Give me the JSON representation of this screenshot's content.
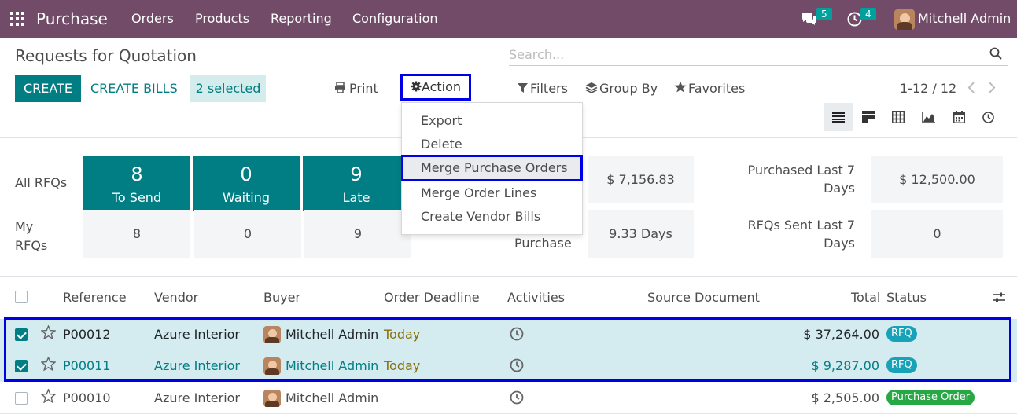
{
  "navbar": {
    "app_name": "Purchase",
    "menu": [
      "Orders",
      "Products",
      "Reporting",
      "Configuration"
    ],
    "messages_count": "5",
    "activities_count": "4",
    "user_name": "Mitchell Admin",
    "bg_color": "#714b67"
  },
  "control_panel": {
    "title": "Requests for Quotation",
    "create_label": "CREATE",
    "create_bills_label": "CREATE BILLS",
    "selected_label": "2 selected",
    "print_label": "Print",
    "action_label": "Action",
    "search_placeholder": "Search...",
    "filters_label": "Filters",
    "group_by_label": "Group By",
    "favorites_label": "Favorites",
    "pager": "1-12 / 12",
    "views": [
      "list-icon",
      "kanban-icon",
      "pivot-icon",
      "graph-icon",
      "calendar-icon",
      "activity-icon"
    ]
  },
  "action_menu": {
    "items": [
      "Export",
      "Delete",
      "Merge Purchase Orders",
      "Merge Order Lines",
      "Create Vendor Bills"
    ],
    "highlighted": "Merge Purchase Orders"
  },
  "dashboard": {
    "all_rfqs_label": "All RFQs",
    "my_rfqs_label": "My RFQs",
    "tiles": [
      {
        "value": "8",
        "label": "To Send",
        "my_value": "8"
      },
      {
        "value": "0",
        "label": "Waiting",
        "my_value": "0"
      },
      {
        "value": "9",
        "label": "Late",
        "my_value": "9"
      }
    ],
    "avg_order_value": "$ 7,156.83",
    "lead_time_label_partial": "Purchase",
    "lead_time_value": "9.33 Days",
    "purchased_last_label": "Purchased Last 7 Days",
    "purchased_last_value": "$ 12,500.00",
    "rfqs_sent_label": "RFQs Sent Last 7 Days",
    "rfqs_sent_value": "0"
  },
  "table": {
    "headers": [
      "Reference",
      "Vendor",
      "Buyer",
      "Order Deadline",
      "Activities",
      "Source Document",
      "Total",
      "Status"
    ],
    "rows": [
      {
        "reference": "P00012",
        "vendor": "Azure Interior",
        "buyer": "Mitchell Admin",
        "deadline": "Today",
        "total": "$ 37,264.00",
        "status": "RFQ",
        "selected": true
      },
      {
        "reference": "P00011",
        "vendor": "Azure Interior",
        "buyer": "Mitchell Admin",
        "deadline": "Today",
        "total": "$ 9,287.00",
        "status": "RFQ",
        "selected": true
      },
      {
        "reference": "P00010",
        "vendor": "Azure Interior",
        "buyer": "Mitchell Admin",
        "deadline": "",
        "total": "$ 2,505.00",
        "status": "Purchase Order",
        "selected": false
      }
    ],
    "status_colors": {
      "RFQ": "#17a2b8",
      "Purchase Order": "#28a745"
    }
  }
}
